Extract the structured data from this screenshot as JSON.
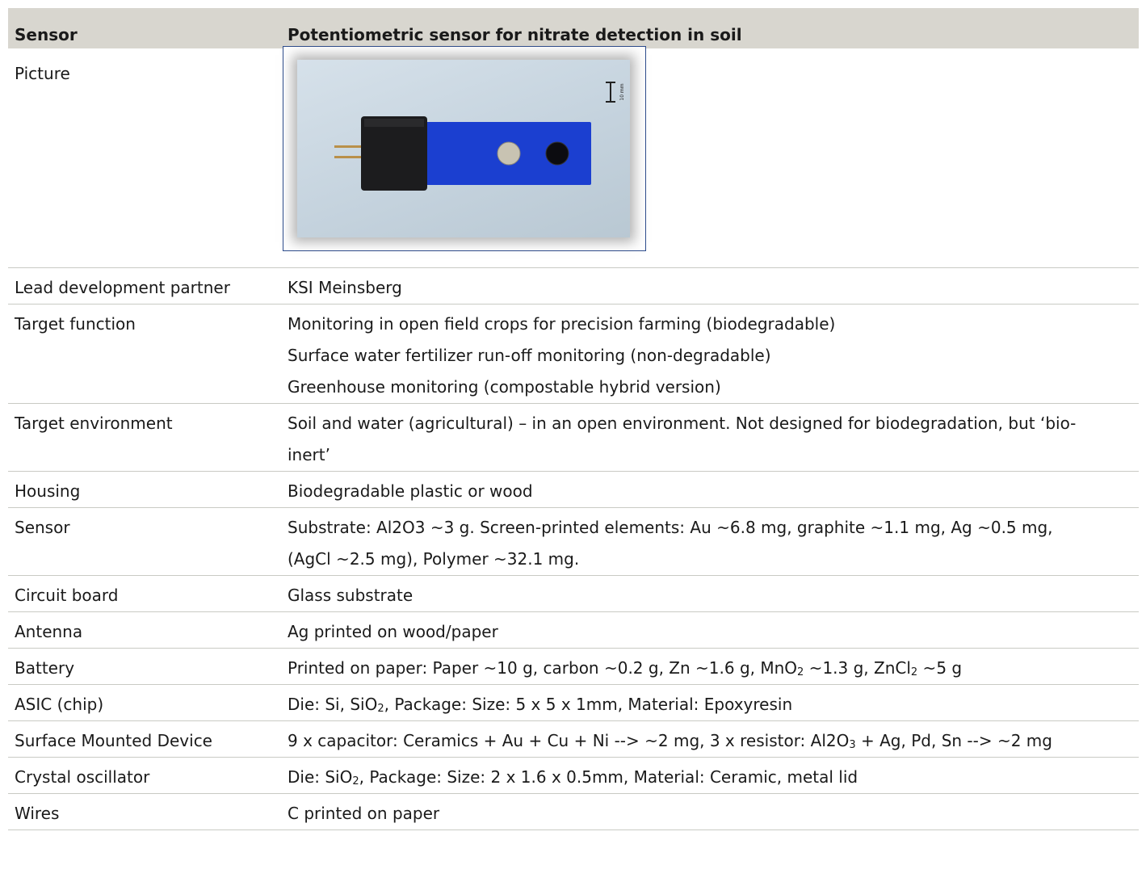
{
  "header": {
    "col1": "Sensor",
    "col2": "Potentiometric sensor for nitrate detection in soil"
  },
  "picture": {
    "label": "Picture",
    "scale_label": "10 mm"
  },
  "rows": {
    "lead": {
      "label": "Lead development partner",
      "value": "KSI Meinsberg"
    },
    "target_function": {
      "label": "Target function",
      "lines": [
        "Monitoring in open field crops for precision farming (biodegradable)",
        "Surface water fertilizer run-off monitoring (non-degradable)",
        "Greenhouse monitoring (compostable hybrid version)"
      ]
    },
    "target_environment": {
      "label": "Target environment",
      "line1": "Soil and water (agricultural) – in an open environment. Not designed for biodegradation, but ‘bio-",
      "line2": "inert’"
    },
    "housing": {
      "label": "Housing",
      "value": "Biodegradable plastic or wood"
    },
    "sensor": {
      "label": "Sensor",
      "line1": "Substrate: Al2O3 ~3 g. Screen-printed elements: Au ~6.8 mg, graphite ~1.1 mg, Ag ~0.5 mg,",
      "line2": "(AgCl ~2.5 mg), Polymer ~32.1 mg."
    },
    "circuit_board": {
      "label": "Circuit board",
      "value": "Glass substrate"
    },
    "antenna": {
      "label": "Antenna",
      "value": "Ag printed on wood/paper"
    },
    "battery": {
      "label": "Battery",
      "p1": "Printed on paper: Paper ~10 g, carbon ~0.2 g, Zn ~1.6 g, MnO",
      "sub1": "2",
      "p2": " ~1.3 g, ZnCl",
      "sub2": "2",
      "p3": " ~5 g"
    },
    "asic": {
      "label": "ASIC (chip)",
      "p1": "Die: Si, SiO",
      "sub1": "2",
      "p2": ", Package: Size: 5 x 5 x 1mm, Material: Epoxyresin"
    },
    "smd": {
      "label": "Surface Mounted Device",
      "p1": "9 x capacitor: Ceramics + Au + Cu + Ni --> ~2 mg, 3 x resistor: Al2O",
      "sub1": "3",
      "p2": " + Ag, Pd, Sn --> ~2 mg"
    },
    "crystal": {
      "label": "Crystal oscillator",
      "p1": "Die: SiO",
      "sub1": "2",
      "p2": ", Package: Size: 2 x 1.6 x 0.5mm, Material: Ceramic, metal lid"
    },
    "wires": {
      "label": "Wires",
      "value": "C printed on paper"
    }
  }
}
